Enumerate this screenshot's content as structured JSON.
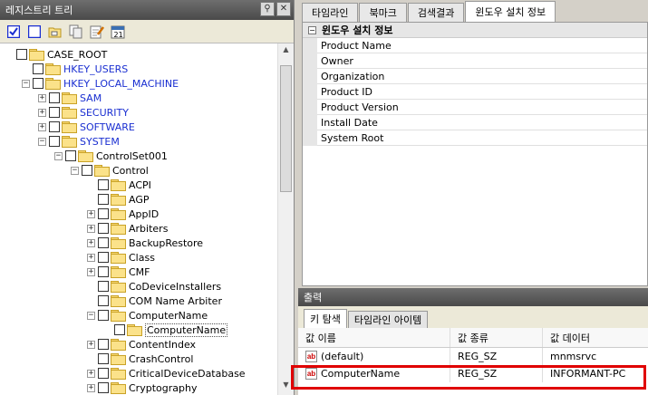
{
  "left": {
    "title": "레지스트리 트리",
    "tree": [
      {
        "label": "CASE_ROOT",
        "depth": 0,
        "exp": "none",
        "color": "black"
      },
      {
        "label": "HKEY_USERS",
        "depth": 1,
        "exp": "none",
        "color": "blue"
      },
      {
        "label": "HKEY_LOCAL_MACHINE",
        "depth": 1,
        "exp": "minus",
        "color": "blue"
      },
      {
        "label": "SAM",
        "depth": 2,
        "exp": "plus",
        "color": "blue"
      },
      {
        "label": "SECURITY",
        "depth": 2,
        "exp": "plus",
        "color": "blue"
      },
      {
        "label": "SOFTWARE",
        "depth": 2,
        "exp": "plus",
        "color": "blue"
      },
      {
        "label": "SYSTEM",
        "depth": 2,
        "exp": "minus",
        "color": "blue"
      },
      {
        "label": "ControlSet001",
        "depth": 3,
        "exp": "minus",
        "color": "black"
      },
      {
        "label": "Control",
        "depth": 4,
        "exp": "minus",
        "color": "black"
      },
      {
        "label": "ACPI",
        "depth": 5,
        "exp": "none",
        "color": "black"
      },
      {
        "label": "AGP",
        "depth": 5,
        "exp": "none",
        "color": "black"
      },
      {
        "label": "AppID",
        "depth": 5,
        "exp": "plus",
        "color": "black"
      },
      {
        "label": "Arbiters",
        "depth": 5,
        "exp": "plus",
        "color": "black"
      },
      {
        "label": "BackupRestore",
        "depth": 5,
        "exp": "plus",
        "color": "black"
      },
      {
        "label": "Class",
        "depth": 5,
        "exp": "plus",
        "color": "black"
      },
      {
        "label": "CMF",
        "depth": 5,
        "exp": "plus",
        "color": "black"
      },
      {
        "label": "CoDeviceInstallers",
        "depth": 5,
        "exp": "none",
        "color": "black"
      },
      {
        "label": "COM Name Arbiter",
        "depth": 5,
        "exp": "none",
        "color": "black"
      },
      {
        "label": "ComputerName",
        "depth": 5,
        "exp": "minus",
        "color": "black"
      },
      {
        "label": "ComputerName",
        "depth": 6,
        "exp": "none",
        "color": "black",
        "selected": true
      },
      {
        "label": "ContentIndex",
        "depth": 5,
        "exp": "plus",
        "color": "black"
      },
      {
        "label": "CrashControl",
        "depth": 5,
        "exp": "none",
        "color": "black"
      },
      {
        "label": "CriticalDeviceDatabase",
        "depth": 5,
        "exp": "plus",
        "color": "black"
      },
      {
        "label": "Cryptography",
        "depth": 5,
        "exp": "plus",
        "color": "black"
      }
    ]
  },
  "tabs": [
    "타임라인",
    "북마크",
    "검색결과",
    "윈도우 설치 정보"
  ],
  "active_tab": 3,
  "props": {
    "group": "윈도우 설치 정보",
    "rows": [
      "Product Name",
      "Owner",
      "Organization",
      "Product ID",
      "Product Version",
      "Install Date",
      "System Root"
    ]
  },
  "output": {
    "title": "출력",
    "tabs": [
      "키 탐색",
      "타임라인 아이템"
    ],
    "columns": [
      "값 이름",
      "값 종류",
      "값 데이터"
    ],
    "rows": [
      {
        "name": "(default)",
        "type": "REG_SZ",
        "data": "mnmsrvc"
      },
      {
        "name": "ComputerName",
        "type": "REG_SZ",
        "data": "INFORMANT-PC"
      }
    ]
  }
}
